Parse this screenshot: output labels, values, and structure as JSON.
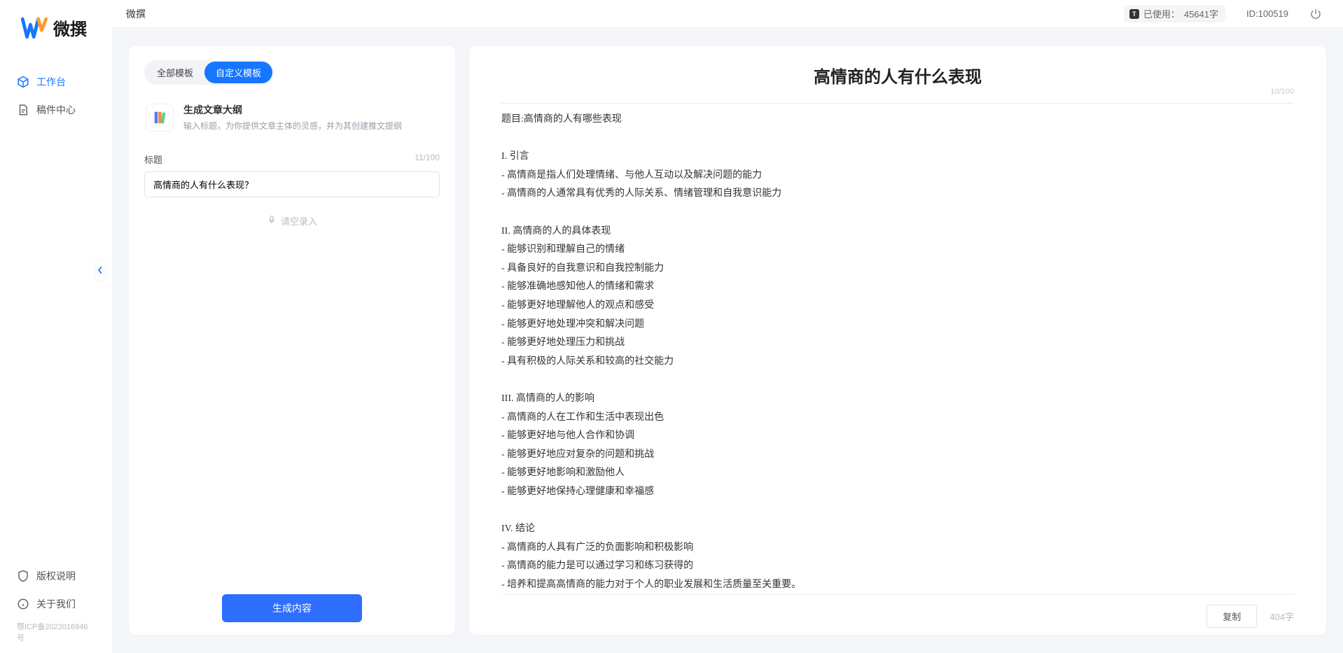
{
  "app": {
    "logoText": "微撰",
    "headerTitle": "微撰"
  },
  "nav": {
    "workbench": "工作台",
    "drafts": "稿件中心",
    "copyright": "版权说明",
    "about": "关于我们",
    "icp": "鄂ICP备2022016946号"
  },
  "header": {
    "usagePrefix": "已使用：",
    "usageValue": "45641字",
    "userId": "ID:100519"
  },
  "leftPanel": {
    "tabs": {
      "all": "全部模板",
      "custom": "自定义模板"
    },
    "template": {
      "title": "生成文章大纲",
      "desc": "输入标题，为你提供文章主体的灵感，并为其创建推文提纲"
    },
    "titleLabel": "标题",
    "titleCount": "11/100",
    "titleValue": "高情商的人有什么表现？",
    "voiceLabel": "请空录入",
    "generateBtn": "生成内容"
  },
  "rightPanel": {
    "docTitle": "高情商的人有什么表现",
    "headCount": "10/100",
    "body": "题目:高情商的人有哪些表现\n\nI. 引言\n- 高情商是指人们处理情绪、与他人互动以及解决问题的能力\n- 高情商的人通常具有优秀的人际关系、情绪管理和自我意识能力\n\nII. 高情商的人的具体表现\n- 能够识别和理解自己的情绪\n- 具备良好的自我意识和自我控制能力\n- 能够准确地感知他人的情绪和需求\n- 能够更好地理解他人的观点和感受\n- 能够更好地处理冲突和解决问题\n- 能够更好地处理压力和挑战\n- 具有积极的人际关系和较高的社交能力\n\nIII. 高情商的人的影响\n- 高情商的人在工作和生活中表现出色\n- 能够更好地与他人合作和协调\n- 能够更好地应对复杂的问题和挑战\n- 能够更好地影响和激励他人\n- 能够更好地保持心理健康和幸福感\n\nIV. 结论\n- 高情商的人具有广泛的负面影响和积极影响\n- 高情商的能力是可以通过学习和练习获得的\n- 培养和提高高情商的能力对于个人的职业发展和生活质量至关重要。",
    "copyBtn": "复制",
    "wordCount": "404字"
  }
}
